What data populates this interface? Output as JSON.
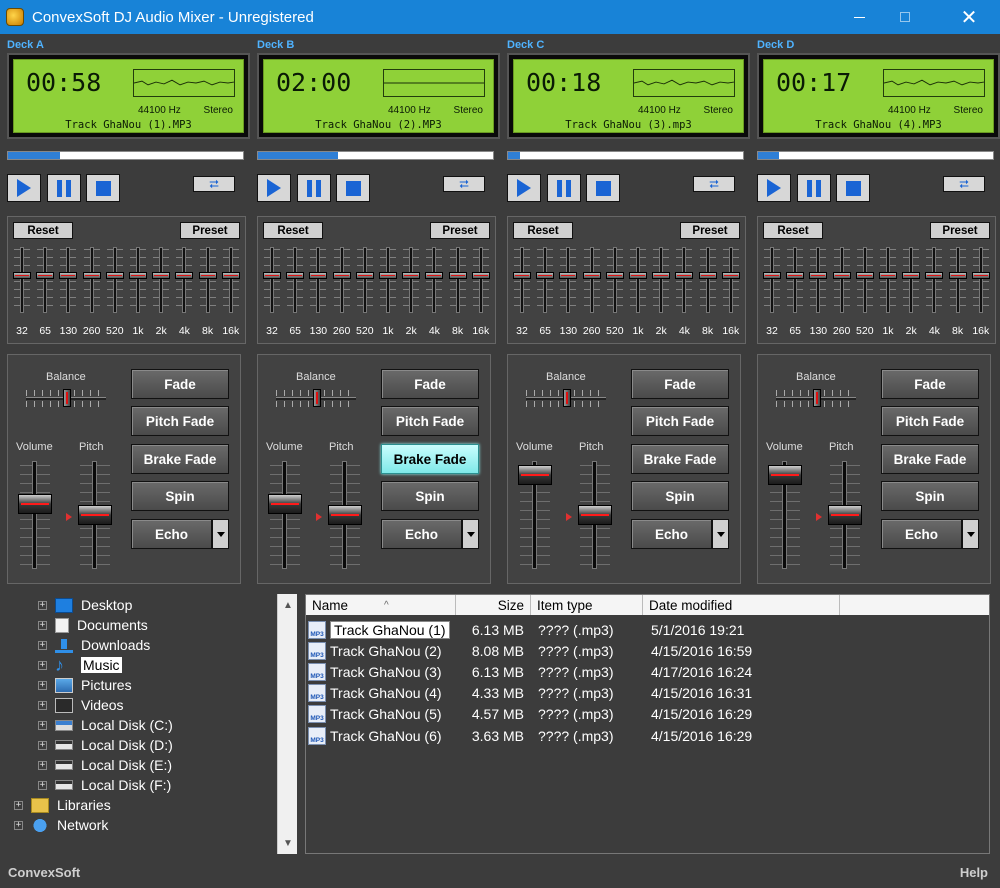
{
  "window": {
    "title": "ConvexSoft DJ Audio Mixer - Unregistered"
  },
  "eq_bands": [
    "32",
    "65",
    "130",
    "260",
    "520",
    "1k",
    "2k",
    "4k",
    "8k",
    "16k"
  ],
  "labels": {
    "reset": "Reset",
    "preset": "Preset",
    "balance": "Balance",
    "volume": "Volume",
    "pitch": "Pitch",
    "fade": "Fade",
    "pitch_fade": "Pitch Fade",
    "brake_fade": "Brake Fade",
    "spin": "Spin",
    "echo": "Echo"
  },
  "decks": [
    {
      "label": "Deck A",
      "time": "00:58",
      "hz": "44100 Hz",
      "mode": "Stereo",
      "track": "Track GhaNou (1).MP3",
      "progress": 0.22,
      "volume": 0.62,
      "pitch": 0.5,
      "active_fx": ""
    },
    {
      "label": "Deck B",
      "time": "02:00",
      "hz": "44100 Hz",
      "mode": "Stereo",
      "track": "Track GhaNou (2).MP3",
      "progress": 0.34,
      "volume": 0.62,
      "pitch": 0.5,
      "active_fx": "brake_fade"
    },
    {
      "label": "Deck C",
      "time": "00:18",
      "hz": "44100 Hz",
      "mode": "Stereo",
      "track": "Track GhaNou (3).mp3",
      "progress": 0.05,
      "volume": 0.95,
      "pitch": 0.5,
      "active_fx": ""
    },
    {
      "label": "Deck D",
      "time": "00:17",
      "hz": "44100 Hz",
      "mode": "Stereo",
      "track": "Track GhaNou (4).MP3",
      "progress": 0.09,
      "volume": 0.95,
      "pitch": 0.5,
      "active_fx": ""
    }
  ],
  "tree": [
    {
      "label": "Desktop",
      "icon": "desktop-icon",
      "indent": 1,
      "selected": false
    },
    {
      "label": "Documents",
      "icon": "documents-icon",
      "indent": 1,
      "selected": false
    },
    {
      "label": "Downloads",
      "icon": "downloads-icon",
      "indent": 1,
      "selected": false
    },
    {
      "label": "Music",
      "icon": "music-icon",
      "indent": 1,
      "selected": true
    },
    {
      "label": "Pictures",
      "icon": "pictures-icon",
      "indent": 1,
      "selected": false
    },
    {
      "label": "Videos",
      "icon": "videos-icon",
      "indent": 1,
      "selected": false
    },
    {
      "label": "Local Disk (C:)",
      "icon": "drive-c-icon",
      "indent": 1,
      "selected": false
    },
    {
      "label": "Local Disk (D:)",
      "icon": "drive-icon",
      "indent": 1,
      "selected": false
    },
    {
      "label": "Local Disk (E:)",
      "icon": "drive-icon",
      "indent": 1,
      "selected": false
    },
    {
      "label": "Local Disk (F:)",
      "icon": "drive-icon",
      "indent": 1,
      "selected": false
    },
    {
      "label": "Libraries",
      "icon": "libraries-icon",
      "indent": 0,
      "selected": false
    },
    {
      "label": "Network",
      "icon": "network-icon",
      "indent": 0,
      "selected": false
    }
  ],
  "files": {
    "columns": {
      "name": "Name",
      "size": "Size",
      "type": "Item type",
      "date": "Date modified"
    },
    "rows": [
      {
        "name": "Track GhaNou (1)",
        "size": "6.13 MB",
        "type": "???? (.mp3)",
        "date": "5/1/2016 19:21",
        "selected": true
      },
      {
        "name": "Track GhaNou (2)",
        "size": "8.08 MB",
        "type": "???? (.mp3)",
        "date": "4/15/2016 16:59",
        "selected": false
      },
      {
        "name": "Track GhaNou (3)",
        "size": "6.13 MB",
        "type": "???? (.mp3)",
        "date": "4/17/2016 16:24",
        "selected": false
      },
      {
        "name": "Track GhaNou (4)",
        "size": "4.33 MB",
        "type": "???? (.mp3)",
        "date": "4/15/2016 16:31",
        "selected": false
      },
      {
        "name": "Track GhaNou (5)",
        "size": "4.57 MB",
        "type": "???? (.mp3)",
        "date": "4/15/2016 16:29",
        "selected": false
      },
      {
        "name": "Track GhaNou (6)",
        "size": "3.63 MB",
        "type": "???? (.mp3)",
        "date": "4/15/2016 16:29",
        "selected": false
      }
    ]
  },
  "status": {
    "left": "ConvexSoft",
    "right": "Help"
  }
}
